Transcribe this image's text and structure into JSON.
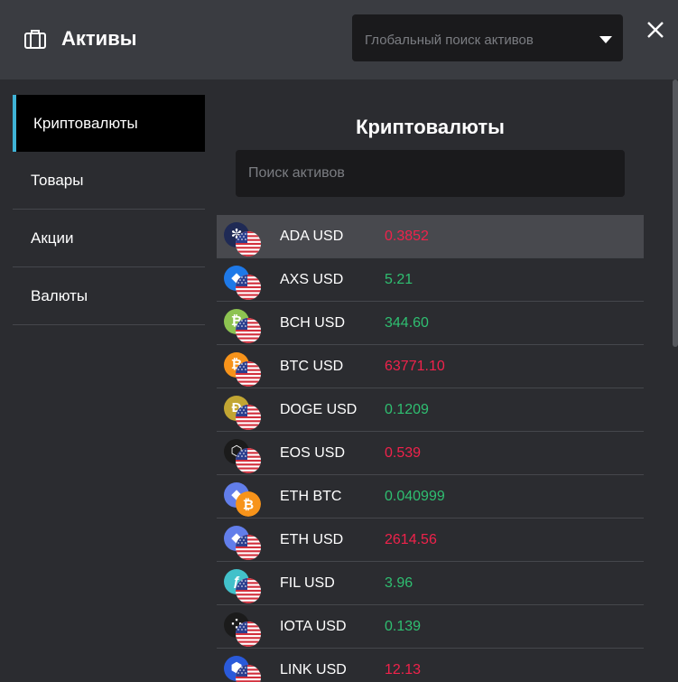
{
  "header": {
    "title": "Активы",
    "global_search_placeholder": "Глобальный поиск активов"
  },
  "sidebar": {
    "items": [
      {
        "label": "Криптовалюты",
        "active": true
      },
      {
        "label": "Товары",
        "active": false
      },
      {
        "label": "Акции",
        "active": false
      },
      {
        "label": "Валюты",
        "active": false
      }
    ]
  },
  "content": {
    "title": "Криптовалюты",
    "search_placeholder": "Поиск активов"
  },
  "colors": {
    "up": "#2fbf71",
    "down": "#f0224b",
    "accent": "#3fb3d6"
  },
  "assets": [
    {
      "name": "ADA USD",
      "price": "0.3852",
      "trend": "down",
      "coin_icon": "cardano-icon",
      "coin_color": "#1f2a55",
      "coin_glyph": "✼",
      "quote_icon": "us-flag-icon"
    },
    {
      "name": "AXS USD",
      "price": "5.21",
      "trend": "up",
      "coin_icon": "axie-infinity-icon",
      "coin_color": "#1e79e8",
      "coin_glyph": "◆",
      "quote_icon": "us-flag-icon"
    },
    {
      "name": "BCH USD",
      "price": "344.60",
      "trend": "up",
      "coin_icon": "bitcoin-cash-icon",
      "coin_color": "#8dc351",
      "coin_glyph": "₿",
      "quote_icon": "us-flag-icon"
    },
    {
      "name": "BTC USD",
      "price": "63771.10",
      "trend": "down",
      "coin_icon": "bitcoin-icon",
      "coin_color": "#f7931a",
      "coin_glyph": "₿",
      "quote_icon": "us-flag-icon"
    },
    {
      "name": "DOGE USD",
      "price": "0.1209",
      "trend": "up",
      "coin_icon": "dogecoin-icon",
      "coin_color": "#c2a633",
      "coin_glyph": "Ð",
      "quote_icon": "us-flag-icon"
    },
    {
      "name": "EOS USD",
      "price": "0.539",
      "trend": "down",
      "coin_icon": "eos-icon",
      "coin_color": "#1b1b1b",
      "coin_glyph": "⬡",
      "quote_icon": "us-flag-icon"
    },
    {
      "name": "ETH BTC",
      "price": "0.040999",
      "trend": "up",
      "coin_icon": "ethereum-icon",
      "coin_color": "#627eea",
      "coin_glyph": "◆",
      "quote_icon": "bitcoin-icon"
    },
    {
      "name": "ETH USD",
      "price": "2614.56",
      "trend": "down",
      "coin_icon": "ethereum-icon",
      "coin_color": "#627eea",
      "coin_glyph": "◆",
      "quote_icon": "us-flag-icon"
    },
    {
      "name": "FIL USD",
      "price": "3.96",
      "trend": "up",
      "coin_icon": "filecoin-icon",
      "coin_color": "#42c1ca",
      "coin_glyph": "ƒ",
      "quote_icon": "us-flag-icon"
    },
    {
      "name": "IOTA USD",
      "price": "0.139",
      "trend": "up",
      "coin_icon": "iota-icon",
      "coin_color": "#1b1b1b",
      "coin_glyph": "⁘",
      "quote_icon": "us-flag-icon"
    },
    {
      "name": "LINK USD",
      "price": "12.13",
      "trend": "down",
      "coin_icon": "chainlink-icon",
      "coin_color": "#2a5ada",
      "coin_glyph": "⬢",
      "quote_icon": "us-flag-icon"
    }
  ]
}
